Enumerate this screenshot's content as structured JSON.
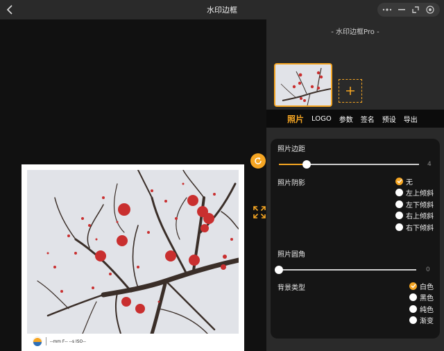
{
  "window": {
    "title": "水印边框",
    "controls": [
      "more-icon",
      "minimize-icon",
      "restore-icon",
      "close-icon"
    ]
  },
  "panel": {
    "title": "- 水印边框Pro -",
    "add_symbol": "+"
  },
  "tabs": [
    {
      "label": "照片",
      "active": true
    },
    {
      "label": "LOGO",
      "active": false
    },
    {
      "label": "参数",
      "active": false
    },
    {
      "label": "签名",
      "active": false
    },
    {
      "label": "预设",
      "active": false
    },
    {
      "label": "导出",
      "active": false
    }
  ],
  "settings": {
    "border": {
      "label": "照片边距",
      "value": "4",
      "fraction": 0.2
    },
    "shadow": {
      "label": "照片阴影",
      "options": [
        "无",
        "左上倾斜",
        "左下倾斜",
        "右上倾斜",
        "右下倾斜"
      ],
      "selected": 0
    },
    "corner": {
      "label": "照片圆角",
      "value": "0",
      "fraction": 0.0
    },
    "background": {
      "label": "背景类型",
      "options": [
        "白色",
        "黑色",
        "纯色",
        "渐变"
      ],
      "selected": 0
    }
  },
  "preview": {
    "caption": "--mm F-- --s ISO--"
  },
  "colors": {
    "accent": "#f6a623",
    "panel": "#2a2a2a",
    "card": "#151515"
  }
}
